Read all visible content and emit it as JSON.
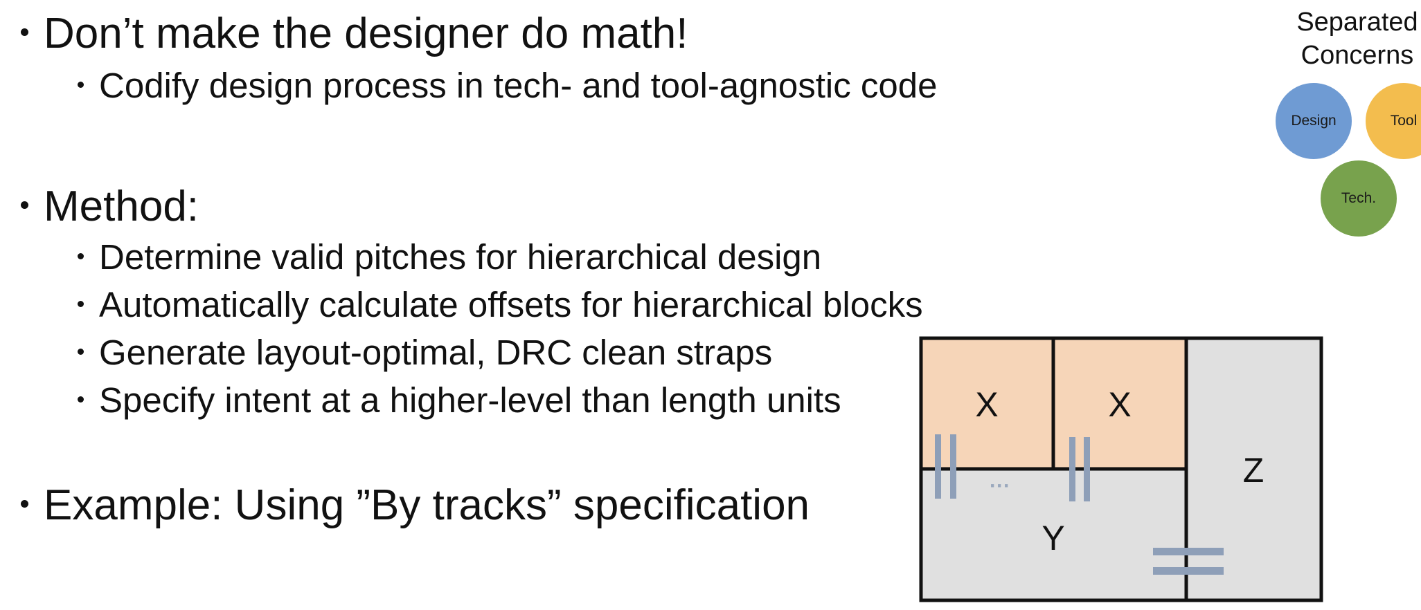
{
  "slide": {
    "bullets": [
      {
        "level": 1,
        "text": "Don’t make the designer do math!"
      },
      {
        "level": 2,
        "text": "Codify design process in tech- and tool-agnostic code"
      },
      {
        "level": 1,
        "text": "Method:"
      },
      {
        "level": 2,
        "text": "Determine valid pitches for hierarchical design"
      },
      {
        "level": 2,
        "text": "Automatically calculate offsets for hierarchical blocks"
      },
      {
        "level": 2,
        "text": "Generate layout-optimal, DRC clean straps"
      },
      {
        "level": 2,
        "text": "Specify intent at a higher-level than length units"
      },
      {
        "level": 1,
        "text": "Example: Using ”By tracks” specification"
      }
    ]
  },
  "concerns": {
    "title_line1": "Separated",
    "title_line2": "Concerns",
    "design_label": "Design",
    "tool_label": "Tool",
    "tech_label": "Tech."
  },
  "diagram": {
    "block_x1": "X",
    "block_x2": "X",
    "block_y": "Y",
    "block_z": "Z",
    "ellipsis": "···",
    "colors": {
      "x_fill": "#f6d5b8",
      "y_fill": "#e0e0e0",
      "z_fill": "#e0e0e0",
      "border": "#111111",
      "strap": "#8e9fb8"
    }
  }
}
